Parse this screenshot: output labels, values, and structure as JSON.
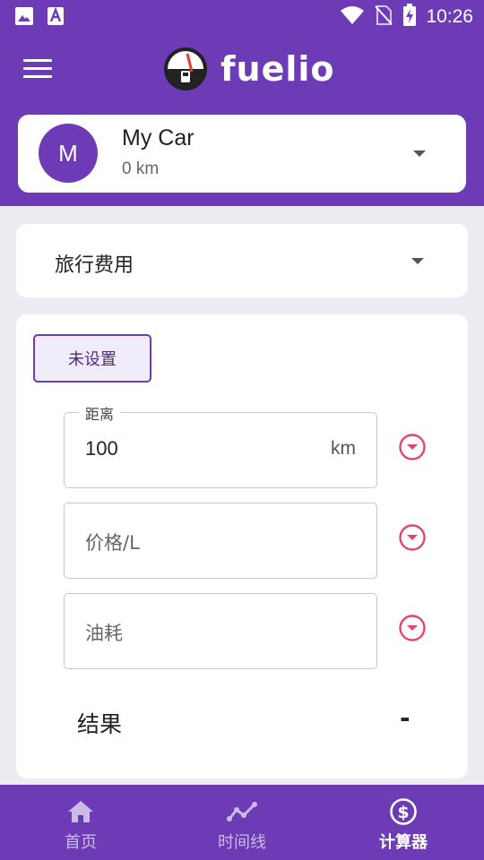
{
  "status_bar": {
    "time": "10:26",
    "icons": [
      "image-icon",
      "font-icon",
      "wifi-icon",
      "no-sim-icon",
      "battery-charging-icon"
    ]
  },
  "app_bar": {
    "brand": "fuelio"
  },
  "vehicle": {
    "avatar_letter": "M",
    "name": "My Car",
    "odometer": "0 km"
  },
  "calculator": {
    "type_label": "旅行费用",
    "preset_button": "未设置",
    "fields": {
      "distance": {
        "label": "距离",
        "value": "100",
        "unit": "km"
      },
      "price": {
        "placeholder": "价格/L"
      },
      "consumption": {
        "placeholder": "油耗"
      }
    },
    "result_label": "结果",
    "result_value": "-"
  },
  "bottom_nav": {
    "items": [
      {
        "label": "首页",
        "icon": "home-icon"
      },
      {
        "label": "时间线",
        "icon": "timeline-icon"
      },
      {
        "label": "计算器",
        "icon": "dollar-circle-icon",
        "active": true
      }
    ]
  },
  "colors": {
    "primary": "#6c3bb5",
    "accent": "#e2456f",
    "background": "#ececf2"
  }
}
